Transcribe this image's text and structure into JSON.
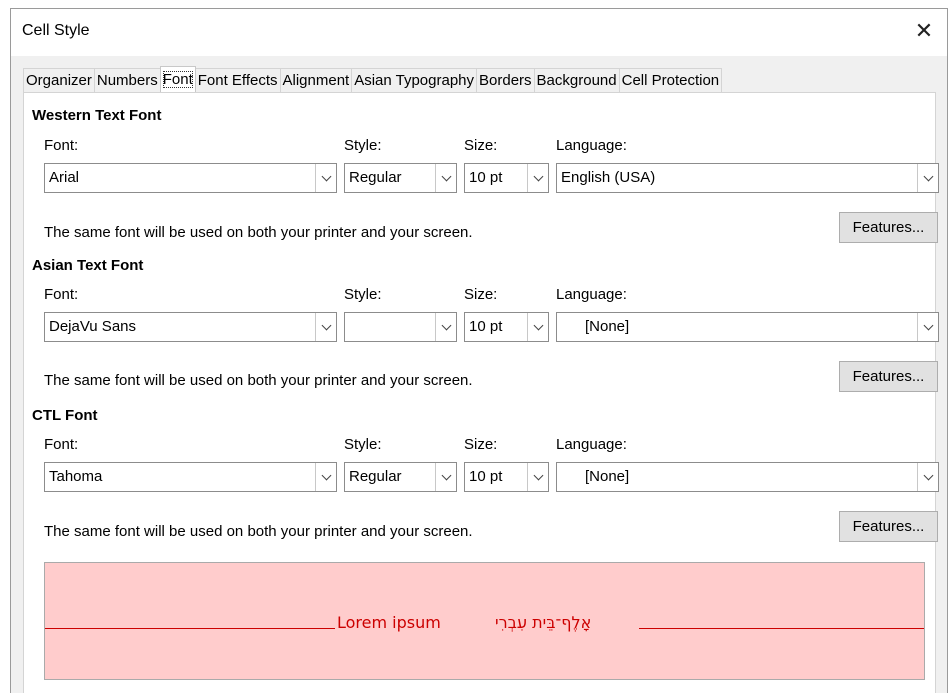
{
  "window": {
    "title": "Cell Style",
    "close_glyph": "✕"
  },
  "tabs": [
    {
      "label": "Organizer",
      "active": false
    },
    {
      "label": "Numbers",
      "active": false
    },
    {
      "label": "Font",
      "active": true
    },
    {
      "label": "Font Effects",
      "active": false
    },
    {
      "label": "Alignment",
      "active": false
    },
    {
      "label": "Asian Typography",
      "active": false
    },
    {
      "label": "Borders",
      "active": false
    },
    {
      "label": "Background",
      "active": false
    },
    {
      "label": "Cell Protection",
      "active": false
    }
  ],
  "western": {
    "title": "Western Text Font",
    "font_label": "Font:",
    "style_label": "Style:",
    "size_label": "Size:",
    "language_label": "Language:",
    "font_value": "Arial",
    "style_value": "Regular",
    "size_value": "10 pt",
    "language_value": "English (USA)",
    "note": "The same font will be used on both your printer and your screen.",
    "features_label": "Features..."
  },
  "asian": {
    "title": "Asian Text Font",
    "font_label": "Font:",
    "style_label": "Style:",
    "size_label": "Size:",
    "language_label": "Language:",
    "font_value": "DejaVu Sans",
    "style_value": "",
    "size_value": "10 pt",
    "language_value": "[None]",
    "note": "The same font will be used on both your printer and your screen.",
    "features_label": "Features..."
  },
  "ctl": {
    "title": "CTL Font",
    "font_label": "Font:",
    "style_label": "Style:",
    "size_label": "Size:",
    "language_label": "Language:",
    "font_value": "Tahoma",
    "style_value": "Regular",
    "size_value": "10 pt",
    "language_value": "[None]",
    "note": "The same font will be used on both your printer and your screen.",
    "features_label": "Features..."
  },
  "preview": {
    "text": "Lorem ipsum",
    "hebrew": "אָלֶף־בֵּית עִבְרִי",
    "background": "#ffcccc",
    "text_color": "#cc0000"
  }
}
